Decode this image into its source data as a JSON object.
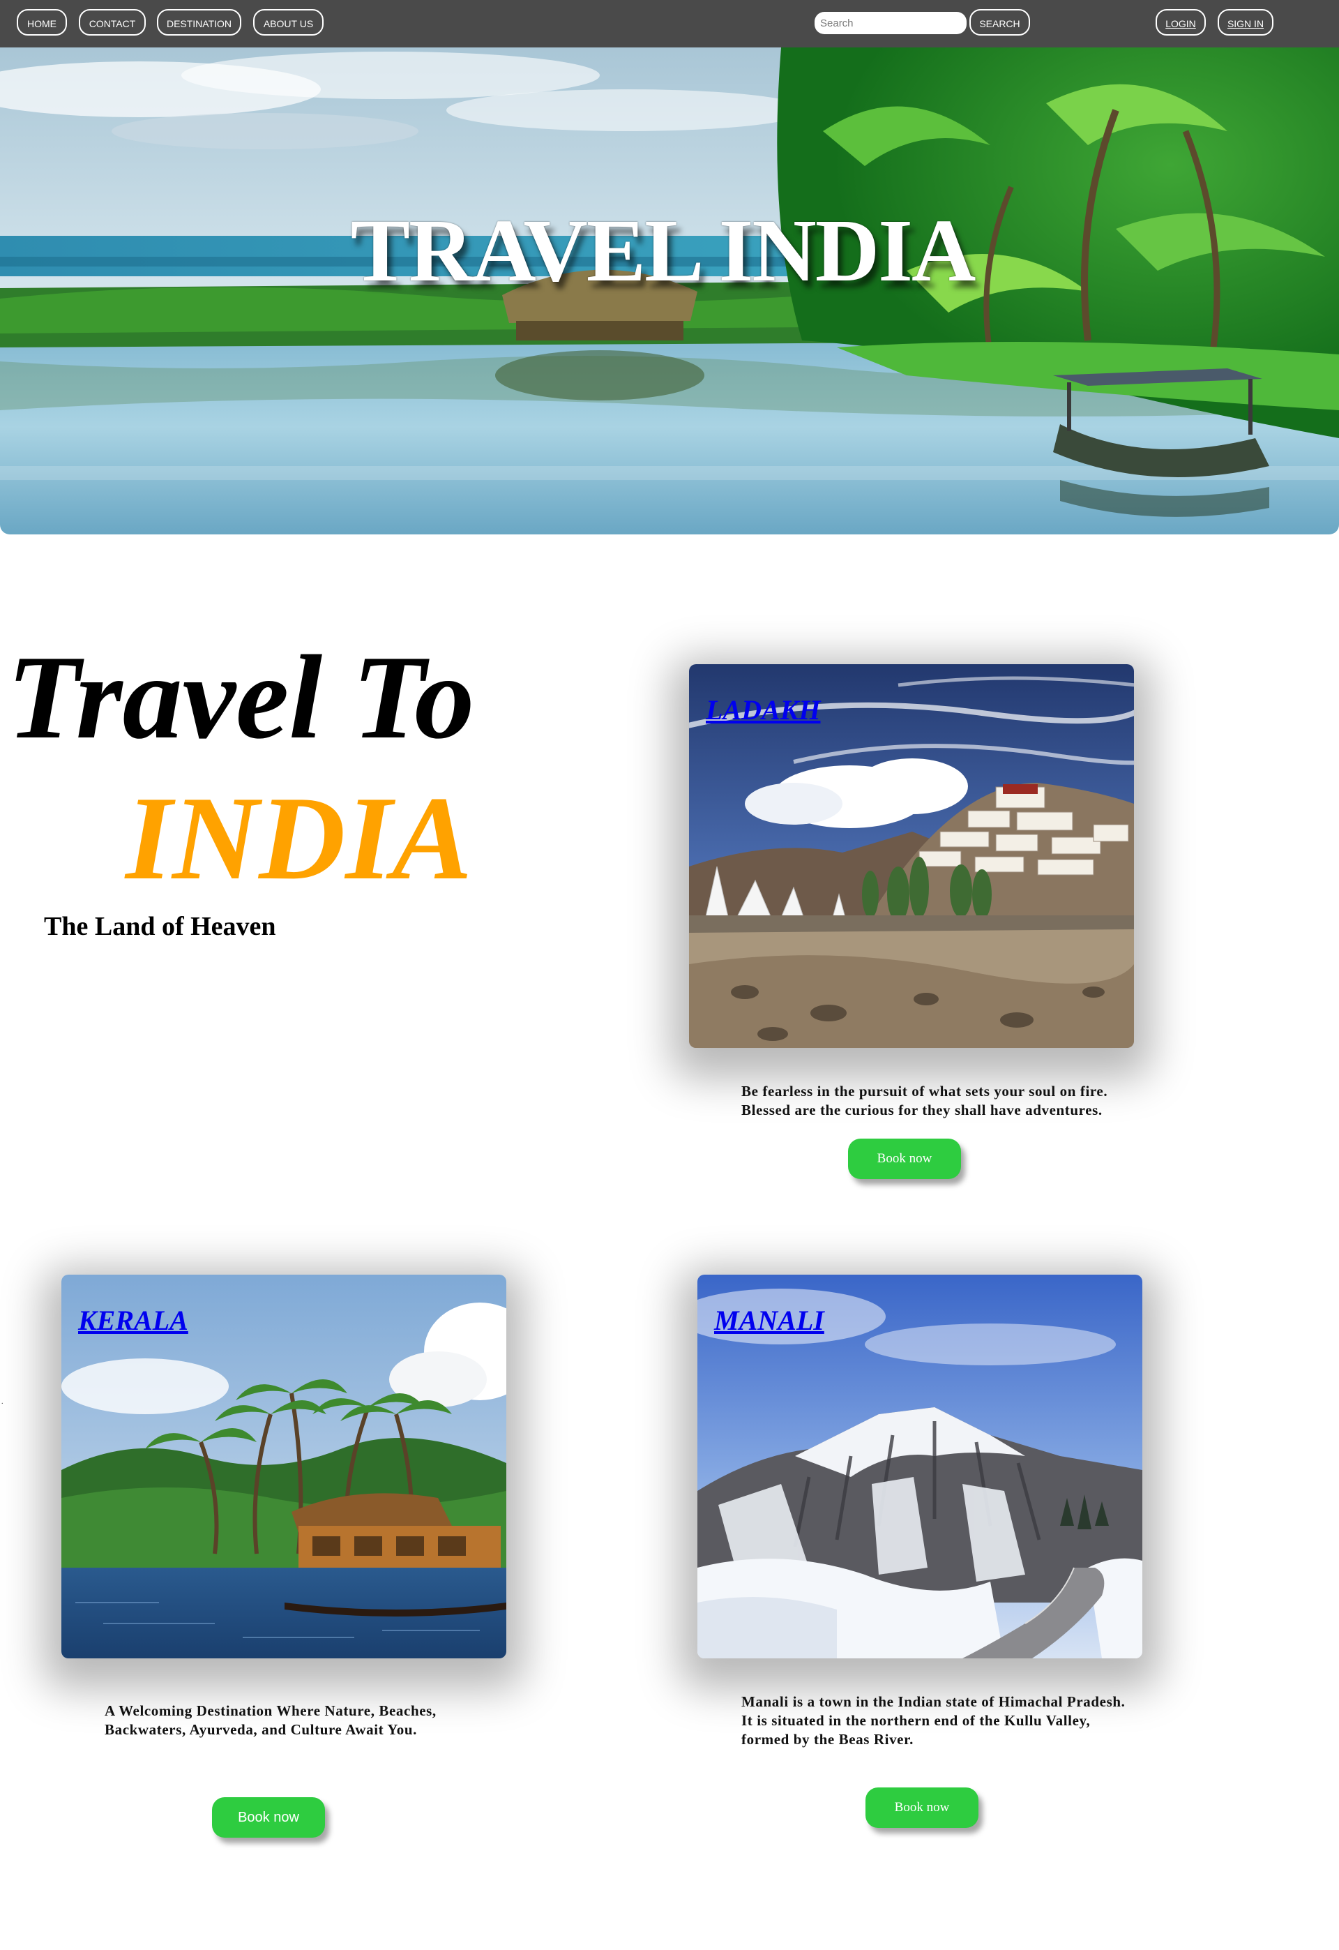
{
  "nav": {
    "home": "HOME",
    "contact": "CONTACT",
    "destination": "DESTINATION",
    "about": "ABOUT US",
    "search_placeholder": "Search",
    "search_button": "SEARCH",
    "login": "LOGIN",
    "signin": "SIGN IN"
  },
  "hero": {
    "title": "TRAVEL INDIA"
  },
  "intro": {
    "line1": "Travel To",
    "line2": "INDIA",
    "tagline": "The Land of Heaven"
  },
  "cards": [
    {
      "title": "LADAKH",
      "description": "Be fearless in the pursuit of what sets your soul on fire.\nBlessed are the curious for they shall have adventures.",
      "button": "Book now"
    },
    {
      "title": "KERALA",
      "description": "A Welcoming Destination Where Nature, Beaches,\nBackwaters, Ayurveda, and Culture Await You.",
      "button": "Book now"
    },
    {
      "title": "MANALI",
      "description": "Manali is a town in the Indian state of Himachal Pradesh.\nIt is situated in the northern end of the Kullu Valley,\nformed by the Beas River.",
      "button": "Book now"
    }
  ],
  "stray_mark": ".",
  "colors": {
    "navbar": "#4a4a4a",
    "accent_orange": "#ffa200",
    "link_blue": "#0000ee",
    "button_green": "#2ecc40"
  }
}
